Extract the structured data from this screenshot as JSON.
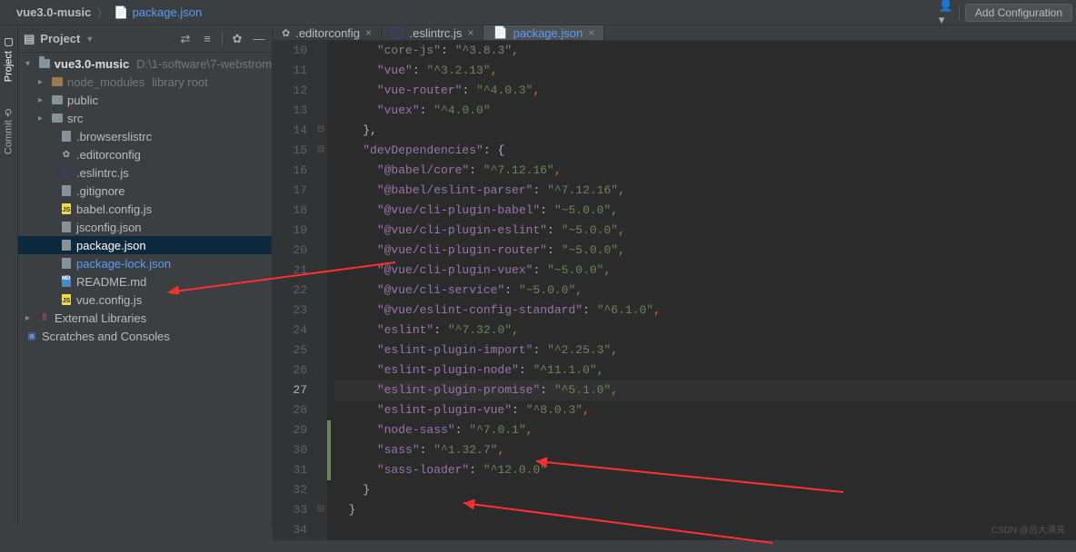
{
  "breadcrumb": {
    "root": "vue3.0-music",
    "file": "package.json"
  },
  "topbar": {
    "add_config": "Add Configuration"
  },
  "panel": {
    "title": "Project"
  },
  "tree": {
    "root": "vue3.0-music",
    "root_path": "D:\\1-software\\7-webstrom",
    "node_modules": "node_modules",
    "node_modules_hint": "library root",
    "public": "public",
    "src": "src",
    "browserslistrc": ".browserslistrc",
    "editorconfig": ".editorconfig",
    "eslintrc": ".eslintrc.js",
    "gitignore": ".gitignore",
    "babel": "babel.config.js",
    "jsconfig": "jsconfig.json",
    "package": "package.json",
    "package_lock": "package-lock.json",
    "readme": "README.md",
    "vueconfig": "vue.config.js",
    "ext_lib": "External Libraries",
    "scratches": "Scratches and Consoles"
  },
  "tabs": {
    "t1": ".editorconfig",
    "t2": ".eslintrc.js",
    "t3": "package.json"
  },
  "code": {
    "lines": [
      {
        "n": 10,
        "ind": 6,
        "kv": [
          "\"core-js\"",
          "\"^3.8.3\""
        ],
        "comma": true,
        "cut": true
      },
      {
        "n": 11,
        "ind": 6,
        "kv": [
          "\"vue\"",
          "\"^3.2.13\""
        ],
        "comma": true
      },
      {
        "n": 12,
        "ind": 6,
        "kv": [
          "\"vue-router\"",
          "\"^4.0.3\""
        ],
        "comma": true
      },
      {
        "n": 13,
        "ind": 6,
        "kv": [
          "\"vuex\"",
          "\"^4.0.0\""
        ],
        "comma": false
      },
      {
        "n": 14,
        "ind": 4,
        "close": "},"
      },
      {
        "n": 15,
        "ind": 4,
        "key": "\"devDependencies\"",
        "open": true
      },
      {
        "n": 16,
        "ind": 6,
        "kv": [
          "\"@babel/core\"",
          "\"^7.12.16\""
        ],
        "comma": true
      },
      {
        "n": 17,
        "ind": 6,
        "kv": [
          "\"@babel/eslint-parser\"",
          "\"^7.12.16\""
        ],
        "comma": true
      },
      {
        "n": 18,
        "ind": 6,
        "kv": [
          "\"@vue/cli-plugin-babel\"",
          "\"~5.0.0\""
        ],
        "comma": true
      },
      {
        "n": 19,
        "ind": 6,
        "kv": [
          "\"@vue/cli-plugin-eslint\"",
          "\"~5.0.0\""
        ],
        "comma": true
      },
      {
        "n": 20,
        "ind": 6,
        "kv": [
          "\"@vue/cli-plugin-router\"",
          "\"~5.0.0\""
        ],
        "comma": true
      },
      {
        "n": 21,
        "ind": 6,
        "kv": [
          "\"@vue/cli-plugin-vuex\"",
          "\"~5.0.0\""
        ],
        "comma": true
      },
      {
        "n": 22,
        "ind": 6,
        "kv": [
          "\"@vue/cli-service\"",
          "\"~5.0.0\""
        ],
        "comma": true
      },
      {
        "n": 23,
        "ind": 6,
        "kv": [
          "\"@vue/eslint-config-standard\"",
          "\"^6.1.0\""
        ],
        "comma": true
      },
      {
        "n": 24,
        "ind": 6,
        "kv": [
          "\"eslint\"",
          "\"^7.32.0\""
        ],
        "comma": true
      },
      {
        "n": 25,
        "ind": 6,
        "kv": [
          "\"eslint-plugin-import\"",
          "\"^2.25.3\""
        ],
        "comma": true
      },
      {
        "n": 26,
        "ind": 6,
        "kv": [
          "\"eslint-plugin-node\"",
          "\"^11.1.0\""
        ],
        "comma": true
      },
      {
        "n": 27,
        "ind": 6,
        "kv": [
          "\"eslint-plugin-promise\"",
          "\"^5.1.0\""
        ],
        "comma": true,
        "current": true
      },
      {
        "n": 28,
        "ind": 6,
        "kv": [
          "\"eslint-plugin-vue\"",
          "\"^8.0.3\""
        ],
        "comma": true
      },
      {
        "n": 29,
        "ind": 6,
        "kv": [
          "\"node-sass\"",
          "\"^7.0.1\""
        ],
        "comma": true,
        "mark": true
      },
      {
        "n": 30,
        "ind": 6,
        "kv": [
          "\"sass\"",
          "\"^1.32.7\""
        ],
        "comma": true,
        "mark": true
      },
      {
        "n": 31,
        "ind": 6,
        "kv": [
          "\"sass-loader\"",
          "\"^12.0.0\""
        ],
        "comma": false,
        "mark": true
      },
      {
        "n": 32,
        "ind": 4,
        "close": "}"
      },
      {
        "n": 33,
        "ind": 2,
        "close": "}"
      },
      {
        "n": 34,
        "ind": 0,
        "blank": true
      }
    ]
  },
  "watermark": "CSDN @吕大漂亮"
}
